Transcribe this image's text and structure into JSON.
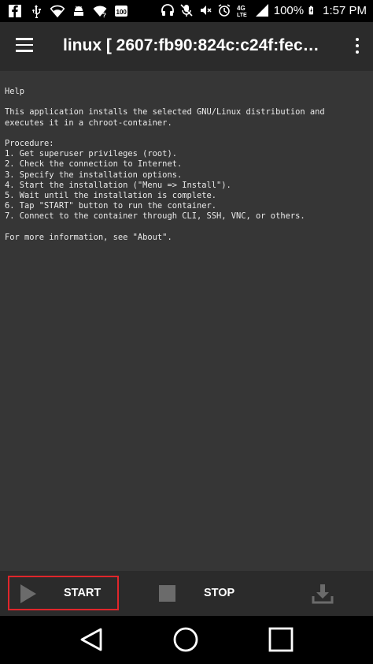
{
  "status_bar": {
    "battery_percent": "100%",
    "time": "1:57 PM",
    "left_icons": [
      "facebook-icon",
      "usb-icon",
      "wifi-icon",
      "android-icon",
      "wifi-question-icon",
      "badge-100-icon"
    ],
    "right_icons": [
      "headphones-icon",
      "mute-icon",
      "no-sound-icon",
      "alarm-icon",
      "lte-icon",
      "signal-icon",
      "battery-icon"
    ]
  },
  "app_bar": {
    "title": "linux  [ 2607:fb90:824c:c24f:fec…",
    "menu_icon": "hamburger-menu-icon",
    "overflow_icon": "more-vert-icon"
  },
  "content": {
    "help_text": "Help\n\nThis application installs the selected GNU/Linux distribution and\nexecutes it in a chroot-container.\n\nProcedure:\n1. Get superuser privileges (root).\n2. Check the connection to Internet.\n3. Specify the installation options.\n4. Start the installation (\"Menu => Install\").\n5. Wait until the installation is complete.\n6. Tap \"START\" button to run the container.\n7. Connect to the container through CLI, SSH, VNC, or others.\n\nFor more information, see \"About\"."
  },
  "toolbar": {
    "start_label": "START",
    "stop_label": "STOP",
    "start_icon": "play-icon",
    "stop_icon": "stop-icon",
    "download_icon": "download-icon"
  },
  "nav_bar": {
    "icons": [
      "back-icon",
      "home-icon",
      "recents-icon"
    ]
  },
  "colors": {
    "background": "#363636",
    "bar": "#2b2b2b",
    "highlight": "#e0262b",
    "text": "#ffffff"
  }
}
